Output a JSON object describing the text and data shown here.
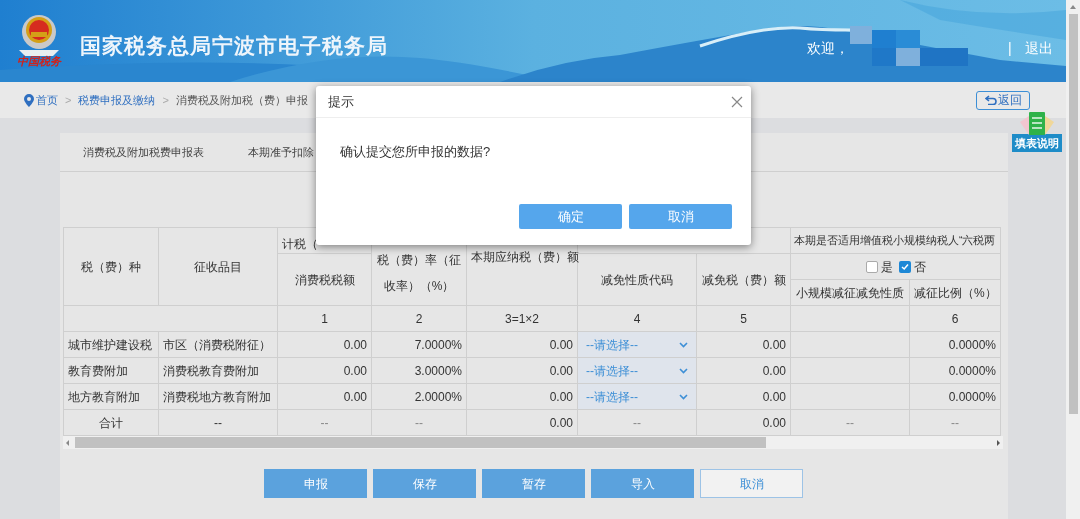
{
  "header": {
    "title": "国家税务总局宁波市电子税务局",
    "logo_text": "中国税务",
    "welcome": "欢迎，",
    "separator": "|",
    "logout": "退出"
  },
  "breadcrumb": [
    {
      "kind": "home",
      "label": "首页"
    },
    {
      "kind": "separator",
      "label": ">"
    },
    {
      "kind": "link",
      "label": "税费申报及缴纳"
    },
    {
      "kind": "separator",
      "label": ">"
    },
    {
      "kind": "current",
      "label": "消费税及附加税（费）申报"
    }
  ],
  "back_button": "返回",
  "help_badge": "填表说明",
  "tabs": [
    {
      "label": "消费税及附加税费申报表"
    },
    {
      "label": "本期准予扣除"
    }
  ],
  "table": {
    "group_headers": [
      "计税（",
      "本期是否适用增值税小规模纳税人“六税两"
    ],
    "options": [
      {
        "label": "是",
        "checked": false
      },
      {
        "label": "否",
        "checked": true
      }
    ],
    "columns": [
      {
        "header": "税（费）种"
      },
      {
        "header": "征收品目"
      },
      {
        "header": "消费税税额",
        "number": "1"
      },
      {
        "header": "税（费）率（征收率）（%）",
        "number": "2"
      },
      {
        "header": "本期应纳税（费）额",
        "number": "3=1×2"
      },
      {
        "header": "减免性质代码",
        "number": "4"
      },
      {
        "header": "减免税（费）额",
        "number": "5"
      },
      {
        "header": "小规模减征减免性质"
      },
      {
        "header": "减征比例（%）",
        "number": "6"
      }
    ],
    "rows": [
      {
        "kind": "data",
        "cells": [
          "城市维护建设税",
          "市区（消费税附征）",
          "0.00",
          "7.0000%",
          "0.00",
          "--请选择--",
          "0.00",
          "",
          "0.0000%"
        ]
      },
      {
        "kind": "data",
        "cells": [
          "教育费附加",
          "消费税教育费附加",
          "0.00",
          "3.0000%",
          "0.00",
          "--请选择--",
          "0.00",
          "",
          "0.0000%"
        ]
      },
      {
        "kind": "data",
        "cells": [
          "地方教育附加",
          "消费税地方教育附加",
          "0.00",
          "2.0000%",
          "0.00",
          "--请选择--",
          "0.00",
          "",
          "0.0000%"
        ]
      },
      {
        "kind": "total",
        "cells": [
          "合计",
          "--",
          "--",
          "--",
          "0.00",
          "--",
          "0.00",
          "--",
          "--"
        ]
      }
    ]
  },
  "actions": [
    {
      "label": "申报",
      "kind": "primary"
    },
    {
      "label": "保存",
      "kind": "primary"
    },
    {
      "label": "暂存",
      "kind": "primary"
    },
    {
      "label": "导入",
      "kind": "primary"
    },
    {
      "label": "取消",
      "kind": "outline"
    }
  ],
  "dialog": {
    "title": "提示",
    "message": "确认提交您所申报的数据?",
    "buttons": [
      "确定",
      "取消"
    ]
  }
}
